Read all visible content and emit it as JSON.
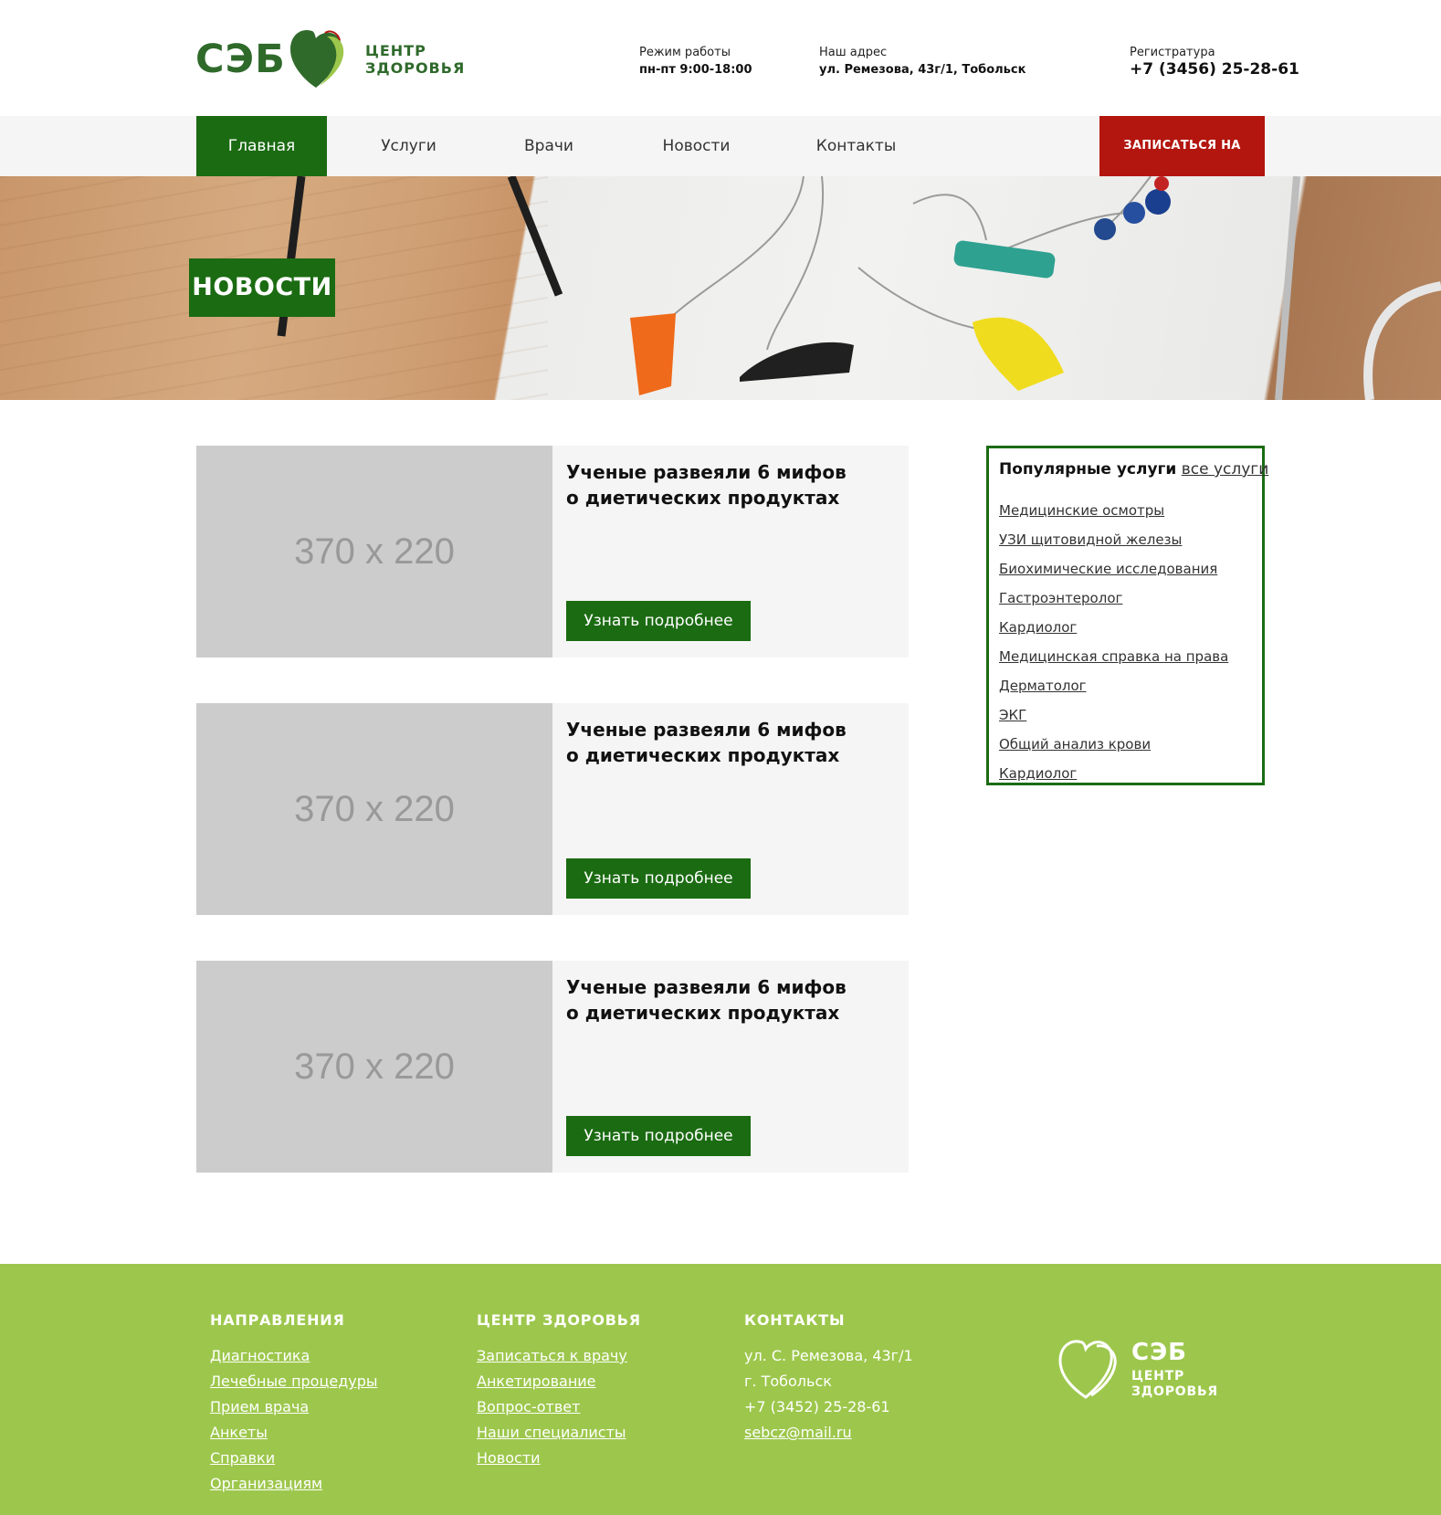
{
  "brand": {
    "logo_abbr": "СЭБ",
    "logo_line1": "ЦЕНТР",
    "logo_line2": "ЗДОРОВЬЯ",
    "primary_color": "#1b6b12",
    "accent_color": "#b3160f",
    "footer_color": "#9dc74c"
  },
  "header": {
    "hours_label": "Режим работы",
    "hours_value": "пн-пт 9:00-18:00",
    "address_label": "Наш адрес",
    "address_value": "ул. Ремезова, 43г/1, Тобольск",
    "registry_label": "Регистратура",
    "registry_phone": "+7 (3456) 25-28-61"
  },
  "nav": {
    "items": [
      {
        "label": "Главная",
        "active": true
      },
      {
        "label": "Услуги",
        "active": false
      },
      {
        "label": "Врачи",
        "active": false
      },
      {
        "label": "Новости",
        "active": false
      },
      {
        "label": "Контакты",
        "active": false
      }
    ],
    "cta_label": "ЗАПИСАТЬСЯ НА ПРИЕМ"
  },
  "hero": {
    "title": "НОВОСТИ"
  },
  "news": [
    {
      "image_placeholder": "370 x 220",
      "title_line1": "Ученые развеяли 6 мифов",
      "title_line2": "о диетических продуктах",
      "button": "Узнать подробнее"
    },
    {
      "image_placeholder": "370 x 220",
      "title_line1": "Ученые развеяли 6 мифов",
      "title_line2": "о диетических продуктах",
      "button": "Узнать подробнее"
    },
    {
      "image_placeholder": "370 x 220",
      "title_line1": "Ученые развеяли 6 мифов",
      "title_line2": "о диетических продуктах",
      "button": "Узнать подробнее"
    }
  ],
  "sidebar": {
    "title": "Популярные услуги",
    "all_link": "все услуги",
    "items": [
      "Медицинские осмотры",
      "УЗИ щитовидной железы",
      "Биохимические исследования",
      "Гастроэнтеролог",
      "Кардиолог",
      "Медицинская справка на права",
      "Дерматолог",
      "ЭКГ",
      "Общий анализ крови",
      "Кардиолог"
    ]
  },
  "footer": {
    "directions": {
      "title": "НАПРАВЛЕНИЯ",
      "items": [
        "Диагностика",
        "Лечебные процедуры",
        "Прием врача",
        "Анкеты",
        "Справки",
        "Организациям"
      ]
    },
    "center": {
      "title": "ЦЕНТР ЗДОРОВЬЯ",
      "items": [
        "Записаться к врачу",
        "Анкетирование",
        "Вопрос-ответ",
        "Наши специалисты",
        "Новости"
      ]
    },
    "contacts": {
      "title": "КОНТАКТЫ",
      "address1": "ул. С. Ремезова, 43г/1",
      "address2": "г. Тобольск",
      "phone": "+7 (3452) 25-28-61",
      "email": "sebcz@mail.ru"
    },
    "logo_abbr": "СЭБ",
    "logo_line1": "ЦЕНТР",
    "logo_line2": "ЗДОРОВЬЯ"
  }
}
